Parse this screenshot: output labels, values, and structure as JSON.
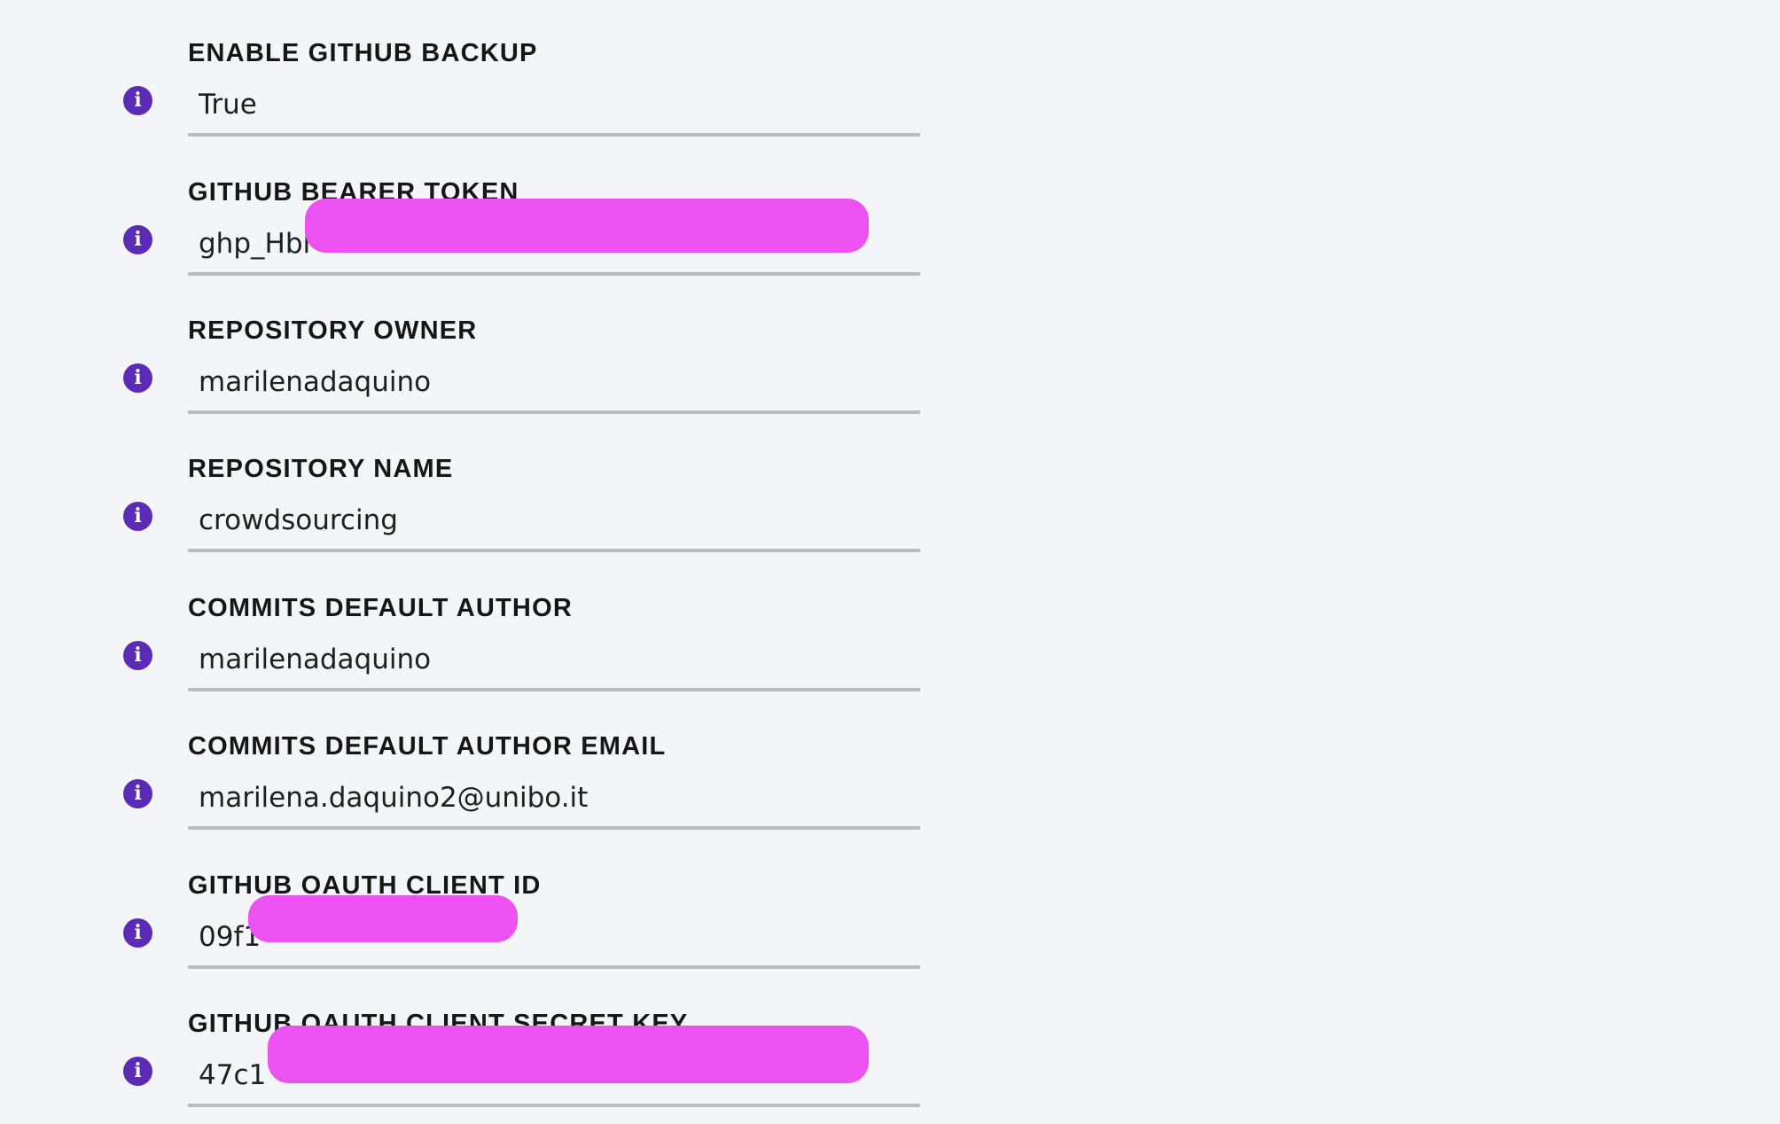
{
  "fields": [
    {
      "label": "ENABLE GITHUB BACKUP",
      "value": "True"
    },
    {
      "label": "GITHUB BEARER TOKEN",
      "value": "ghp_Hbl"
    },
    {
      "label": "REPOSITORY OWNER",
      "value": "marilenadaquino"
    },
    {
      "label": "REPOSITORY NAME",
      "value": "crowdsourcing"
    },
    {
      "label": "COMMITS DEFAULT AUTHOR",
      "value": "marilenadaquino"
    },
    {
      "label": "COMMITS DEFAULT AUTHOR EMAIL",
      "value": "marilena.daquino2@unibo.it"
    },
    {
      "label": "GITHUB OAUTH CLIENT ID",
      "value": "09f1"
    },
    {
      "label": "GITHUB OAUTH CLIENT SECRET KEY",
      "value": "47c1"
    }
  ],
  "info_icon_glyph": "i",
  "colors": {
    "background": "#f4f5f9",
    "info_icon": "#5b2bb5",
    "redaction": "#ec52f2",
    "underline": "#bcbcbe"
  }
}
